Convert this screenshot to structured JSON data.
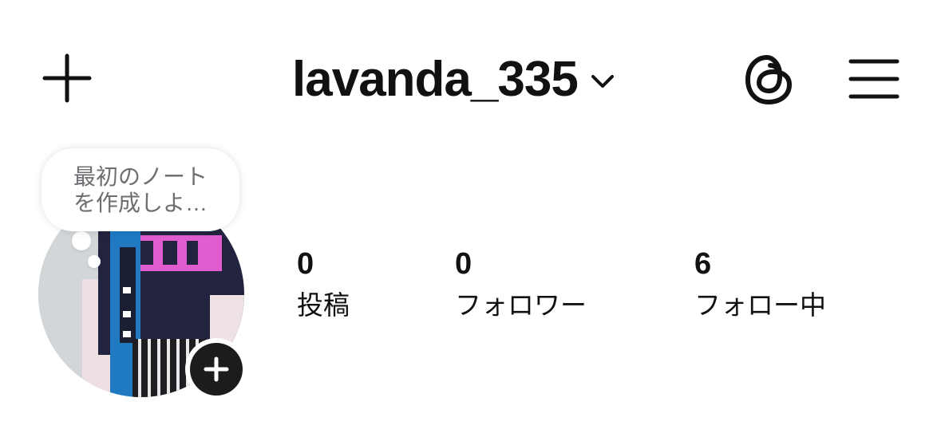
{
  "header": {
    "username": "lavanda_335",
    "add_icon": "plus-icon",
    "dropdown_icon": "chevron-down-icon",
    "threads_icon": "threads-icon",
    "menu_icon": "hamburger-menu-icon"
  },
  "note": {
    "text": "最初のノート\nを作成しよ…"
  },
  "avatar": {
    "add_story_icon": "plus-icon"
  },
  "stats": [
    {
      "value": "0",
      "label": "投稿"
    },
    {
      "value": "0",
      "label": "フォロワー"
    },
    {
      "value": "6",
      "label": "フォロー中"
    }
  ],
  "colors": {
    "text": "#111111",
    "note_text": "#6e6e73",
    "add_story_bg": "#1c1c1e",
    "background": "#ffffff"
  }
}
